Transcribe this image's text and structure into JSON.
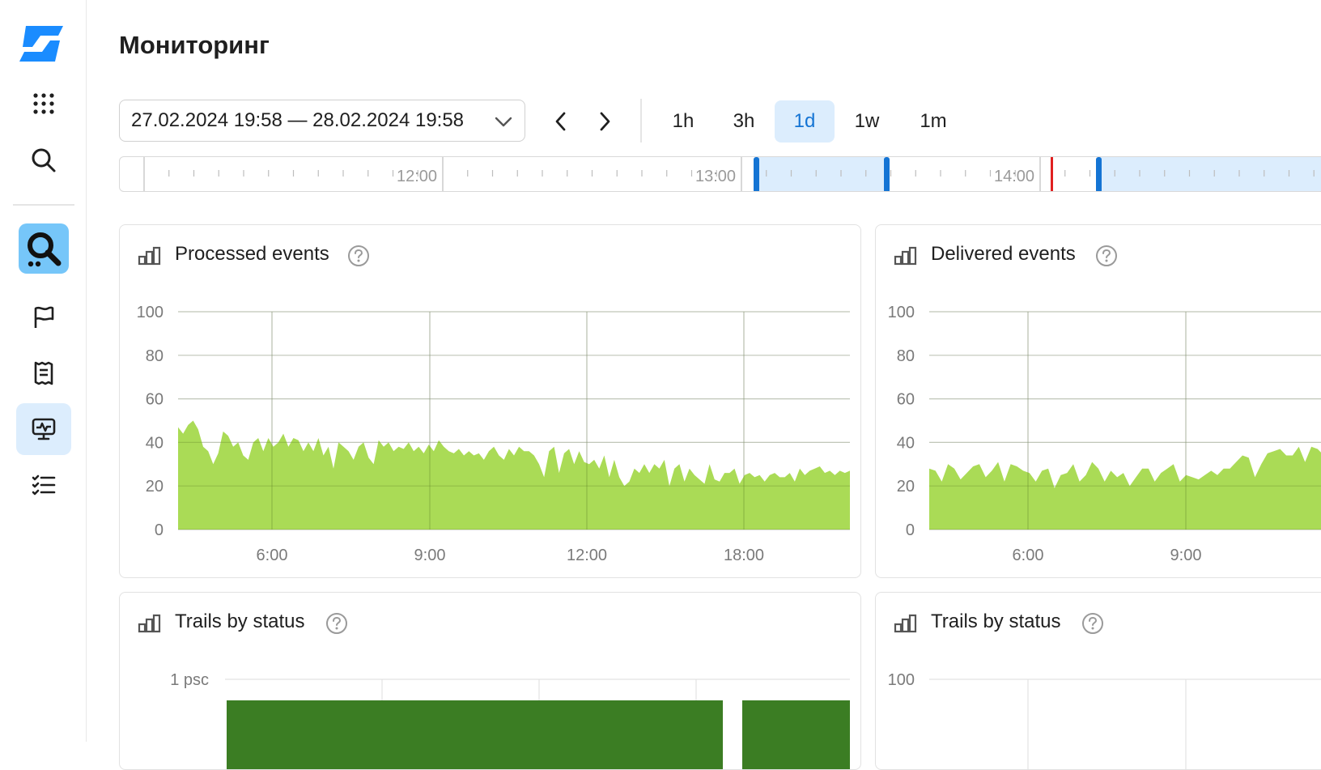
{
  "page": {
    "title": "Мониторинг"
  },
  "sidebar": {
    "items": [
      {
        "icon": "apps-grid-icon"
      },
      {
        "icon": "search-icon"
      },
      {
        "icon": "audit-trails-logo-icon",
        "active": true
      },
      {
        "icon": "flag-icon"
      },
      {
        "icon": "receipt-icon"
      },
      {
        "icon": "monitoring-icon",
        "active": true
      },
      {
        "icon": "checklist-icon"
      }
    ]
  },
  "toolbar": {
    "date_range": "27.02.2024 19:58 — 28.02.2024 19:58",
    "zoom_options": [
      "1h",
      "3h",
      "1d",
      "1w",
      "1m"
    ],
    "zoom_selected": "1d"
  },
  "timeline": {
    "labels": [
      "12:00",
      "13:00",
      "14:00"
    ]
  },
  "colors": {
    "accent": "#1474d4",
    "area_fill": "#a3d848",
    "bar_fill": "#3b7d23",
    "selection": "#dcedfd",
    "now_marker": "#e02020"
  },
  "cards": [
    {
      "title": "Processed events"
    },
    {
      "title": "Delivered events"
    },
    {
      "title": "Trails by status"
    },
    {
      "title": "Trails by status"
    }
  ],
  "chart_data": [
    {
      "type": "area",
      "title": "Processed events",
      "ylim": [
        0,
        100
      ],
      "yticks": [
        "100",
        "80",
        "60",
        "40",
        "20",
        "0"
      ],
      "xticks": [
        "6:00",
        "9:00",
        "12:00",
        "18:00"
      ],
      "series": [
        {
          "values": [
            47,
            44,
            48,
            50,
            46,
            38,
            36,
            30,
            35,
            45,
            43,
            38,
            40,
            34,
            32,
            40,
            42,
            36,
            42,
            38,
            40,
            44,
            38,
            42,
            41,
            36,
            40,
            36,
            42,
            34,
            38,
            28,
            40,
            38,
            36,
            32,
            38,
            40,
            33,
            30,
            41,
            38,
            40,
            36,
            38,
            37,
            40,
            36,
            38,
            35,
            39,
            36,
            41,
            38,
            36,
            35,
            37,
            34,
            36,
            34,
            35,
            32,
            36,
            38,
            34,
            32,
            37,
            34,
            38,
            36,
            36,
            34,
            30,
            24,
            36,
            38,
            26,
            35,
            37,
            30,
            36,
            31,
            30,
            32,
            28,
            34,
            24,
            32,
            24,
            20,
            22,
            28,
            26,
            30,
            26,
            30,
            28,
            32,
            20,
            28,
            30,
            22,
            28,
            25,
            23,
            21,
            30,
            23,
            22,
            26,
            26,
            28,
            21,
            25,
            26,
            24,
            25,
            22,
            25,
            26,
            24,
            24,
            26,
            22,
            28,
            25,
            27,
            28,
            29,
            26,
            27,
            25,
            27,
            26,
            27
          ]
        }
      ]
    },
    {
      "type": "area",
      "title": "Delivered events",
      "ylim": [
        0,
        100
      ],
      "yticks": [
        "100",
        "80",
        "60",
        "40",
        "20",
        "0"
      ],
      "xticks": [
        "6:00",
        "9:00"
      ],
      "series": [
        {
          "values": [
            28,
            27,
            22,
            30,
            28,
            23,
            26,
            29,
            30,
            24,
            27,
            31,
            22,
            30,
            29,
            27,
            26,
            22,
            27,
            28,
            19,
            25,
            26,
            30,
            22,
            25,
            31,
            28,
            22,
            27,
            24,
            26,
            20,
            24,
            28,
            28,
            22,
            26,
            28,
            30,
            22,
            25,
            24,
            23,
            25,
            27,
            25,
            28,
            28,
            31,
            34,
            33,
            24,
            30,
            35,
            36,
            37,
            34,
            34,
            38,
            31,
            38,
            37,
            34,
            37,
            39,
            38,
            37,
            38,
            36
          ]
        }
      ]
    },
    {
      "type": "bar",
      "title": "Trails by status",
      "yticks": [
        "1 psc"
      ],
      "series": [
        {
          "values": [
            1,
            1,
            0,
            1
          ]
        }
      ]
    },
    {
      "type": "area",
      "title": "Trails by status",
      "yticks": [
        "100"
      ]
    }
  ]
}
